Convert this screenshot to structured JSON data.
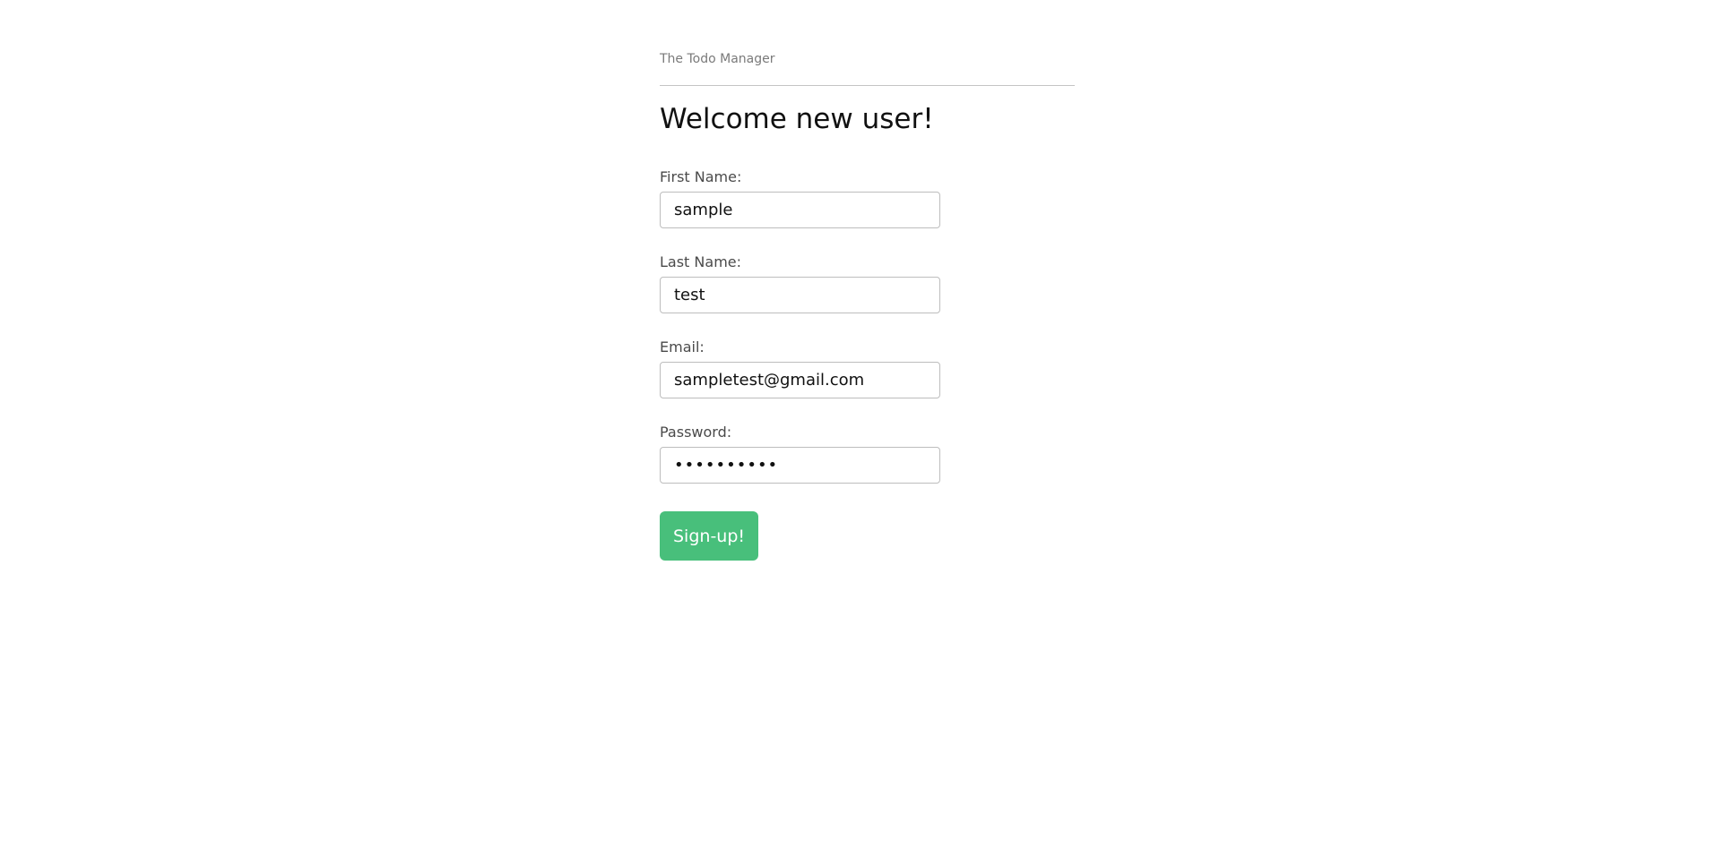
{
  "header": {
    "app_title": "The Todo Manager"
  },
  "main": {
    "page_title": "Welcome new user!",
    "form": {
      "first_name": {
        "label": "First Name:",
        "value": "sample"
      },
      "last_name": {
        "label": "Last Name:",
        "value": "test"
      },
      "email": {
        "label": "Email:",
        "value": "sampletest@gmail.com"
      },
      "password": {
        "label": "Password:",
        "value": "samplepass"
      },
      "submit_label": "Sign-up!"
    }
  },
  "colors": {
    "accent": "#48bf7b",
    "muted_text": "#7a7a7a",
    "label_text": "#4a4a4a"
  }
}
